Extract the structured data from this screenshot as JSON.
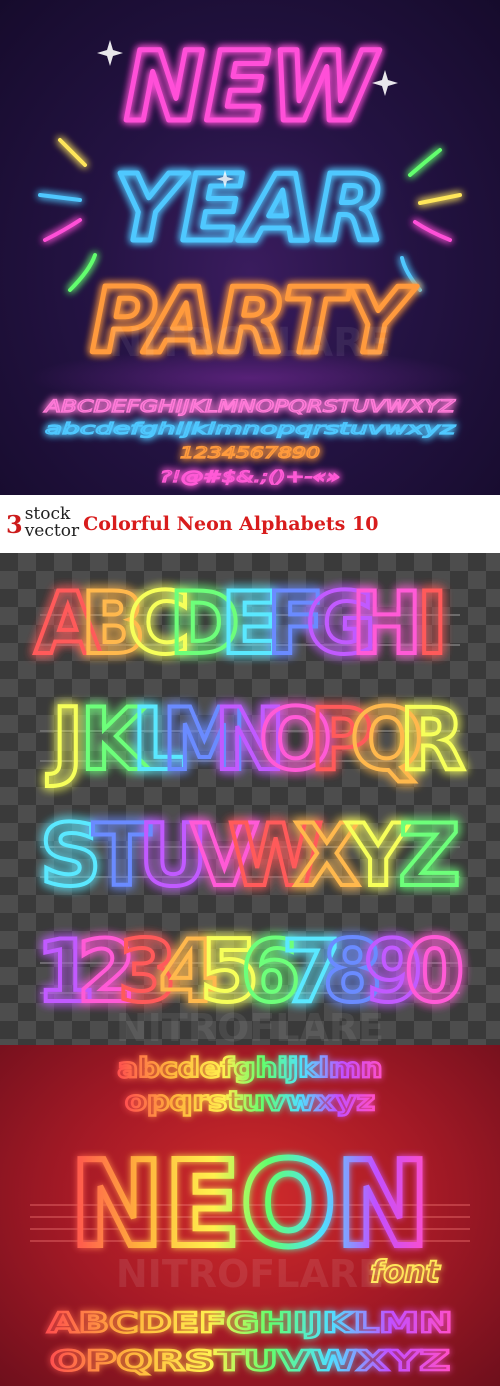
{
  "panel1": {
    "headline": [
      "NEW",
      "YEAR",
      "PARTY"
    ],
    "alphabet_upper": "ABCDEFGHIJKLMNOPQRSTUVWXYZ",
    "alphabet_lower": "abcdefghijklmnopqrstuvwxyz",
    "digits": "1234567890",
    "symbols": "?!@#$&.;()+-«»",
    "watermark": "NITROFLARE",
    "colors": {
      "pink": "#ff4fd8",
      "blue": "#4fc8ff",
      "orange": "#ff9a3c"
    }
  },
  "banner": {
    "number": "3",
    "logo_line1": "stock",
    "logo_line2": "vector",
    "title": "Colorful Neon Alphabets 10"
  },
  "panel2": {
    "rows": [
      "ABCDEFGHI",
      "JKLMNOPQR",
      "STUVWXYZ",
      "1234567890"
    ],
    "watermark": "NITROFLARE",
    "colors": [
      "#ff5a5a",
      "#ffb84d",
      "#f6ff5a",
      "#6dff7a",
      "#5ae8ff",
      "#6b8bff",
      "#c15aff",
      "#ff5ad6"
    ]
  },
  "panel3": {
    "lower_line1": "abcdefghijklmn",
    "lower_line2": "opqrstuvwxyz",
    "neon_word": "NEON",
    "font_word": "font",
    "upper_line1": "ABCDEFGHIJKLMN",
    "upper_line2": "OPQRSTUVWXYZ",
    "watermark": "NITROFLARE",
    "colors": [
      "#ff4f4f",
      "#ffb43c",
      "#fff04f",
      "#62ff6e",
      "#4fe0ff",
      "#5b7bff",
      "#c24fff",
      "#ff4fc8"
    ]
  }
}
